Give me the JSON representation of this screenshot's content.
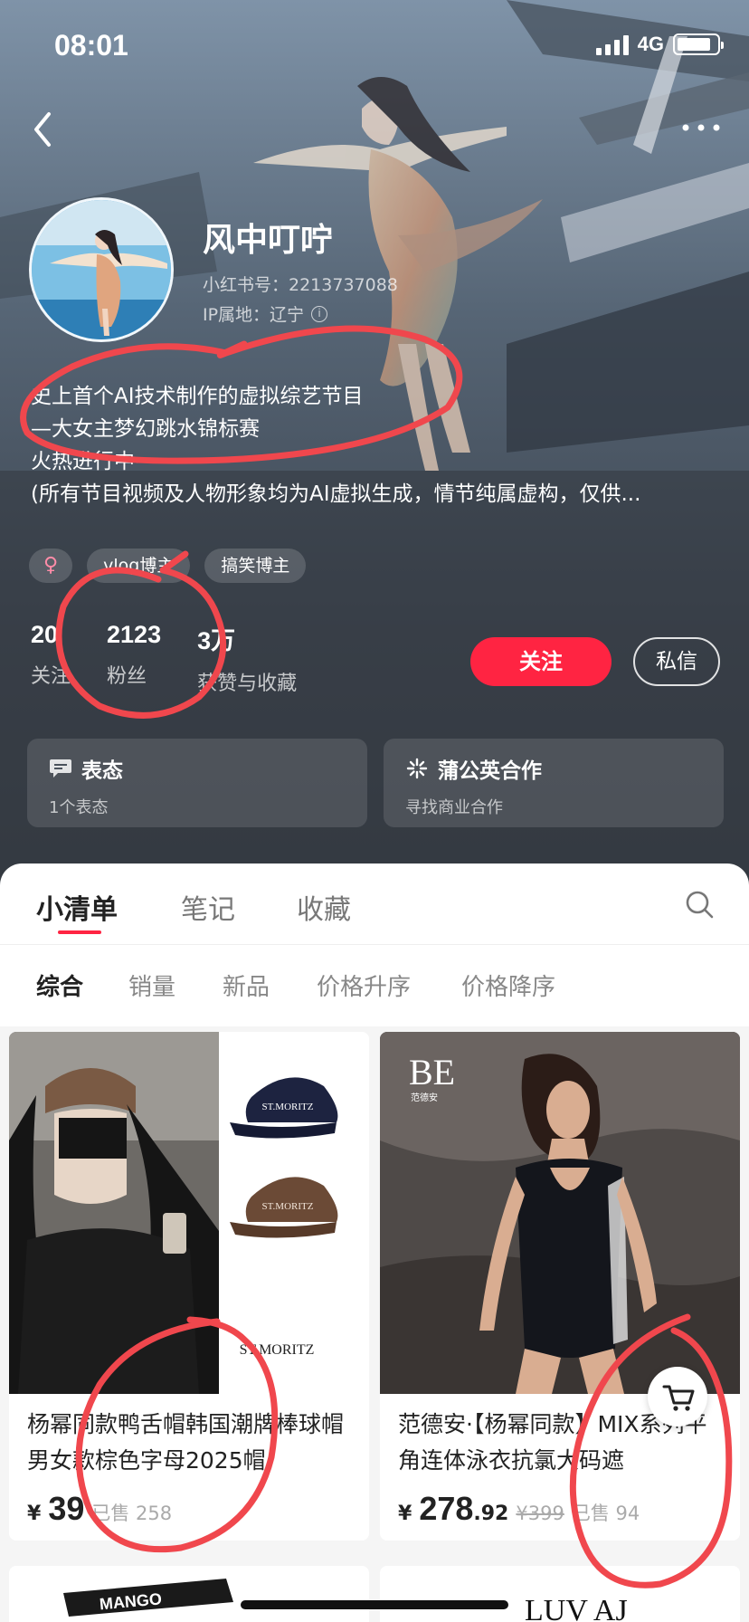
{
  "status_bar": {
    "time": "08:01",
    "network": "4G",
    "battery_level": 0.85
  },
  "profile": {
    "nickname": "风中叮咛",
    "red_id": "小红书号：2213737088",
    "ip": "IP属地：辽宁",
    "bio_lines": [
      "史上首个AI技术制作的虚拟综艺节目",
      "—大女主梦幻跳水锦标赛",
      "火热进行中~",
      "(所有节目视频及人物形象均为AI虚拟生成，情节纯属虚构，仅供..."
    ],
    "tags": {
      "gender": "♀",
      "tag1": "vlog博主",
      "tag2": "搞笑博主"
    },
    "stats": [
      {
        "num": "20",
        "label": "关注"
      },
      {
        "num": "2123",
        "label": "粉丝"
      },
      {
        "num": "3万",
        "label": "获赞与收藏"
      }
    ],
    "follow_label": "关注",
    "message_label": "私信",
    "cards": [
      {
        "title": "表态",
        "sub": "1个表态",
        "icon": "chat-bubble-icon"
      },
      {
        "title": "蒲公英合作",
        "sub": "寻找商业合作",
        "icon": "dandelion-icon"
      }
    ]
  },
  "tabs": [
    "小清单",
    "笔记",
    "收藏"
  ],
  "filters": [
    "综合",
    "销量",
    "新品",
    "价格升序",
    "价格降序"
  ],
  "products": [
    {
      "name": "杨幂同款鸭舌帽韩国潮牌棒球帽男女款棕色字母2025帽",
      "price_symbol": "¥",
      "price_int": "39",
      "price_dec": "",
      "price_old": "",
      "sold": "已售 258",
      "image_text": "ST.MORITZ",
      "cap_text_1": "ST.MORITZ",
      "cap_text_2": "ST.MORITZ"
    },
    {
      "name": "范德安·【杨幂同款】MIX系列平角连体泳衣抗氯大码遮",
      "price_symbol": "¥",
      "price_int": "278",
      "price_dec": ".92",
      "price_old": "¥399",
      "sold": "已售 94",
      "image_logo": "BE",
      "image_logo_sub": "范德安"
    }
  ],
  "next_row": {
    "left_text": "MANGO",
    "right_text": "LUV AJ"
  },
  "colors": {
    "accent": "#ff2442",
    "annotation": "#f0474d"
  }
}
